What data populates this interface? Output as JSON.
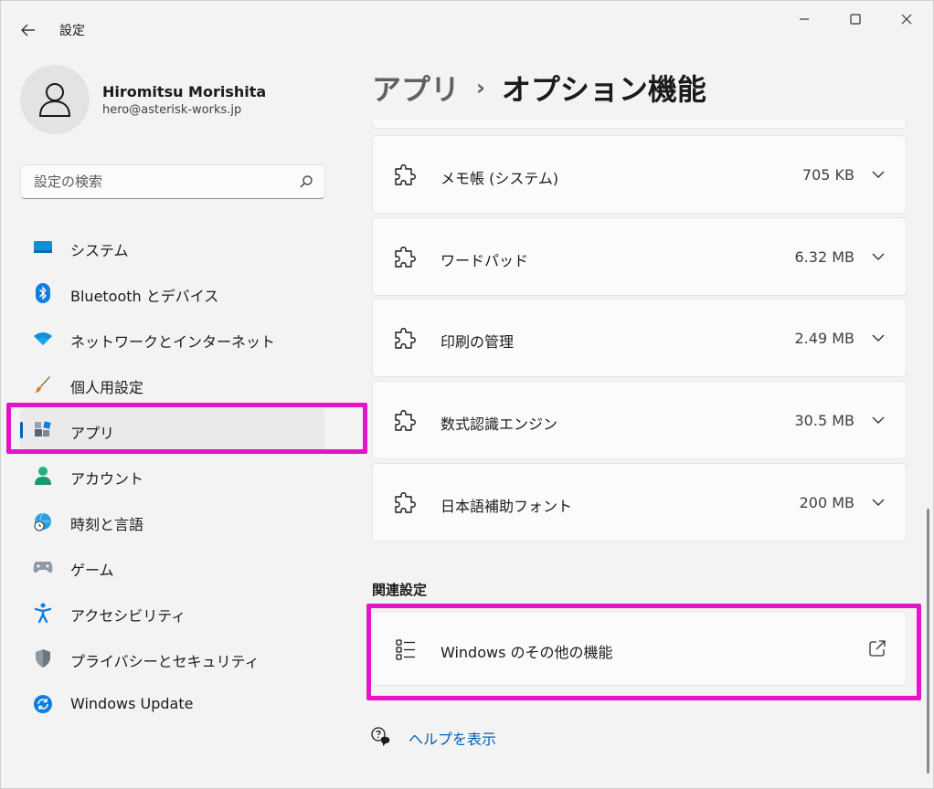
{
  "window": {
    "app_title": "設定"
  },
  "profile": {
    "name": "Hiromitsu Morishita",
    "email": "hero@asterisk-works.jp"
  },
  "search": {
    "placeholder": "設定の検索"
  },
  "sidebar": {
    "items": [
      {
        "label": "システム",
        "icon": "system-monitor-icon",
        "active": false
      },
      {
        "label": "Bluetooth とデバイス",
        "icon": "bluetooth-icon",
        "active": false
      },
      {
        "label": "ネットワークとインターネット",
        "icon": "wifi-icon",
        "active": false
      },
      {
        "label": "個人用設定",
        "icon": "paintbrush-icon",
        "active": false
      },
      {
        "label": "アプリ",
        "icon": "apps-icon",
        "active": true
      },
      {
        "label": "アカウント",
        "icon": "account-icon",
        "active": false
      },
      {
        "label": "時刻と言語",
        "icon": "globe-clock-icon",
        "active": false
      },
      {
        "label": "ゲーム",
        "icon": "gamepad-icon",
        "active": false
      },
      {
        "label": "アクセシビリティ",
        "icon": "accessibility-icon",
        "active": false
      },
      {
        "label": "プライバシーとセキュリティ",
        "icon": "shield-icon",
        "active": false
      },
      {
        "label": "Windows Update",
        "icon": "windows-update-icon",
        "active": false
      }
    ]
  },
  "breadcrumb": {
    "parent": "アプリ",
    "separator": "›",
    "current": "オプション機能"
  },
  "features": [
    {
      "name": "メモ帳 (システム)",
      "size": "705 KB"
    },
    {
      "name": "ワードパッド",
      "size": "6.32 MB"
    },
    {
      "name": "印刷の管理",
      "size": "2.49 MB"
    },
    {
      "name": "数式認識エンジン",
      "size": "30.5 MB"
    },
    {
      "name": "日本語補助フォント",
      "size": "200 MB"
    }
  ],
  "related": {
    "title": "関連設定",
    "item_label": "Windows のその他の機能"
  },
  "help": {
    "label": "ヘルプを表示"
  },
  "colors": {
    "accent": "#005fb8",
    "highlight": "#e514c6",
    "link": "#0060b8"
  }
}
